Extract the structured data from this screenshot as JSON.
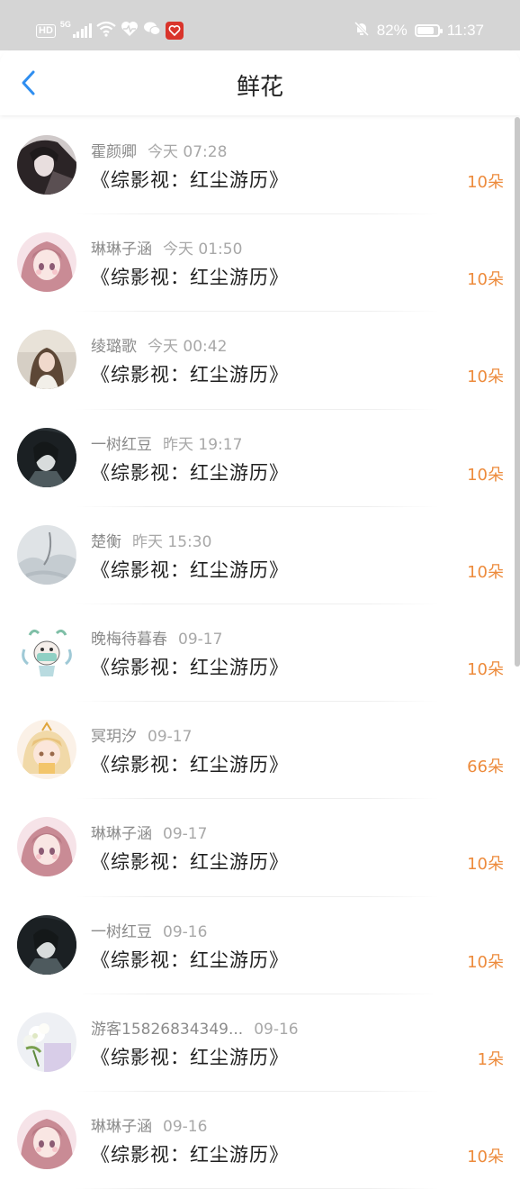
{
  "status_bar": {
    "hd": "HD",
    "network": "5G",
    "battery_text": "82%",
    "battery_level": 0.82,
    "time": "11:37"
  },
  "header": {
    "title": "鲜花"
  },
  "colors": {
    "accent_blue": "#2f8ef0",
    "count_orange": "#ed8b3c"
  },
  "items": [
    {
      "name": "霍颜卿",
      "date": "今天 07:28",
      "title": "《综影视：红尘游历》",
      "count": "10朵",
      "avatar": "gothic-girl"
    },
    {
      "name": "琳琳子涵",
      "date": "今天 01:50",
      "title": "《综影视：红尘游历》",
      "count": "10朵",
      "avatar": "pink-anime-girl"
    },
    {
      "name": "绫璐歌",
      "date": "今天 00:42",
      "title": "《综影视：红尘游历》",
      "count": "10朵",
      "avatar": "photo-girl"
    },
    {
      "name": "一树红豆",
      "date": "昨天 19:17",
      "title": "《综影视：红尘游历》",
      "count": "10朵",
      "avatar": "dark-hair-character"
    },
    {
      "name": "楚衡",
      "date": "昨天 15:30",
      "title": "《综影视：红尘游历》",
      "count": "10朵",
      "avatar": "misty-landscape"
    },
    {
      "name": "晚梅待暮春",
      "date": "09-17",
      "title": "《综影视：红尘游历》",
      "count": "10朵",
      "avatar": "chibi-masked"
    },
    {
      "name": "冥玥汐",
      "date": "09-17",
      "title": "《综影视：红尘游历》",
      "count": "66朵",
      "avatar": "blonde-chibi"
    },
    {
      "name": "琳琳子涵",
      "date": "09-17",
      "title": "《综影视：红尘游历》",
      "count": "10朵",
      "avatar": "pink-anime-girl"
    },
    {
      "name": "一树红豆",
      "date": "09-16",
      "title": "《综影视：红尘游历》",
      "count": "10朵",
      "avatar": "dark-hair-character"
    },
    {
      "name": "游客15826834349...",
      "date": "09-16",
      "title": "《综影视：红尘游历》",
      "count": "1朵",
      "avatar": "flower-bouquet"
    },
    {
      "name": "琳琳子涵",
      "date": "09-16",
      "title": "《综影视：红尘游历》",
      "count": "10朵",
      "avatar": "pink-anime-girl"
    }
  ]
}
